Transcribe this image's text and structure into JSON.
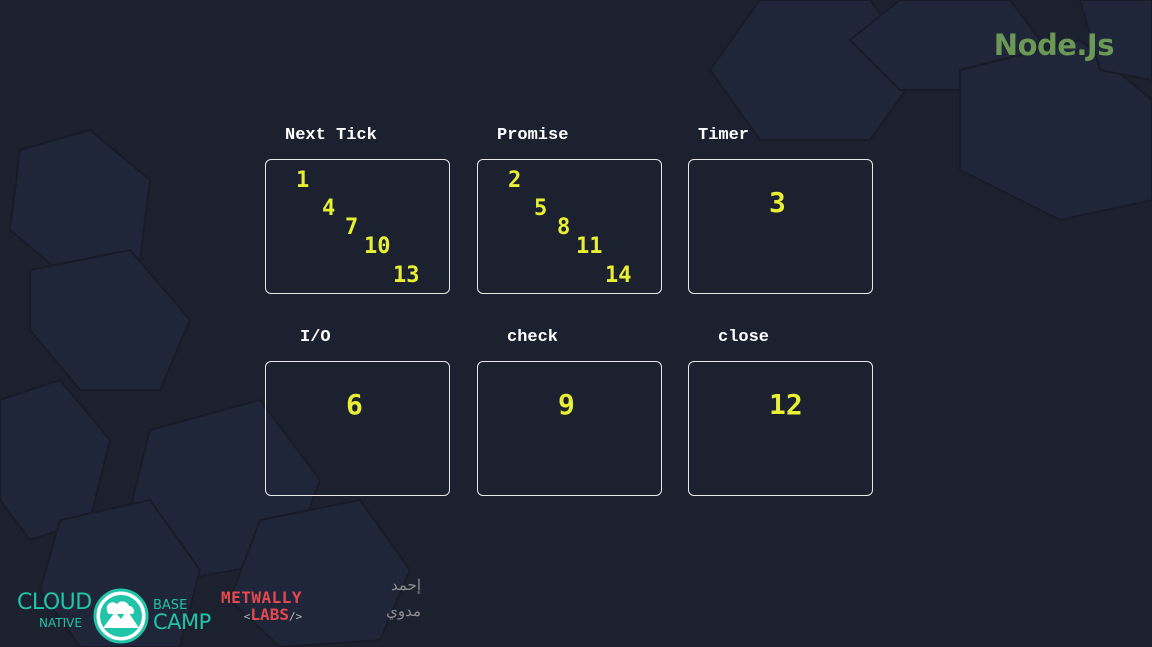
{
  "brand": {
    "title": "Node.Js"
  },
  "queues": {
    "next_tick": {
      "label": "Next Tick",
      "values": [
        "1",
        "4",
        "7",
        "10",
        "13"
      ]
    },
    "promise": {
      "label": "Promise",
      "values": [
        "2",
        "5",
        "8",
        "11",
        "14"
      ]
    },
    "timer": {
      "label": "Timer",
      "values": [
        "3"
      ]
    },
    "io": {
      "label": "I/O",
      "values": [
        "6"
      ]
    },
    "check": {
      "label": "check",
      "values": [
        "9"
      ]
    },
    "close": {
      "label": "close",
      "values": [
        "12"
      ]
    }
  },
  "footer": {
    "cloud_native": {
      "cloud": "CLOUD",
      "native": "NATIVE",
      "base": "BASE",
      "camp": "CAMP"
    },
    "metwally_labs": {
      "metwally": "METWALLY",
      "labs": "LABS",
      "open_tag": "<",
      "close_tag": "/>"
    },
    "signature": {
      "line1": "إحمد",
      "line2": "مدوي"
    }
  },
  "colors": {
    "background": "#1c2130",
    "brand": "#6a9955",
    "number": "#e9ef35",
    "label": "#ffffff",
    "box_border": "#e8e8e8",
    "cloud_native": "#20c4a8",
    "labs": "#e5484d"
  }
}
